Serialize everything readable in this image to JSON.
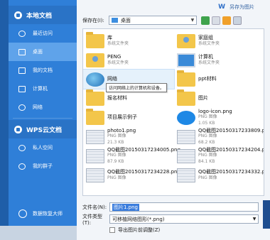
{
  "sidebar": {
    "local_header": "本地文档",
    "items": [
      {
        "label": "最近访问",
        "icon": "clock-icon",
        "active": false
      },
      {
        "label": "桌面",
        "icon": "desktop-icon",
        "active": true
      },
      {
        "label": "我的文档",
        "icon": "folder-icon",
        "active": false
      },
      {
        "label": "计算机",
        "icon": "computer-icon",
        "active": false
      },
      {
        "label": "网络",
        "icon": "network-icon",
        "active": false
      }
    ],
    "cloud_header": "WPS云文档",
    "cloud_items": [
      {
        "label": "私人空间",
        "icon": "person-icon"
      },
      {
        "label": "我的群子",
        "icon": "group-icon"
      }
    ],
    "bottom": "数据恢复大师"
  },
  "topbar": {
    "save_as_image": "另存为图片"
  },
  "savein": {
    "label": "保存在(I):",
    "value": "桌面"
  },
  "files": [
    {
      "name": "库",
      "type": "系统文件夹",
      "icon": "library-icon"
    },
    {
      "name": "家庭组",
      "type": "系统文件夹",
      "icon": "homegroup-icon"
    },
    {
      "name": "PENG",
      "type": "系统文件夹",
      "icon": "user-folder-icon"
    },
    {
      "name": "计算机",
      "type": "系统文件夹",
      "icon": "computer-icon"
    },
    {
      "name": "网络",
      "type": "",
      "icon": "network-icon",
      "tooltip": "访问网络上的计算机和设备。"
    },
    {
      "name": "ppt材料",
      "type": "",
      "icon": "folder-icon"
    },
    {
      "name": "报名材料",
      "type": "",
      "icon": "folder-icon"
    },
    {
      "name": "图片",
      "type": "",
      "icon": "folder-icon"
    },
    {
      "name": "项目展示例子",
      "type": "",
      "icon": "folder-icon"
    },
    {
      "name": "logo-icon.png",
      "type": "PNG 图像",
      "size": "1.05 KB",
      "icon": "cloud-image-icon"
    },
    {
      "name": "photo1.png",
      "type": "PNG 图像",
      "size": "21.3 KB",
      "icon": "image-icon"
    },
    {
      "name": "QQ截图20150317233809.png",
      "type": "PNG 图像",
      "size": "68.2 KB",
      "icon": "image-icon"
    },
    {
      "name": "QQ截图20150317234005.png",
      "type": "PNG 图像",
      "size": "87.9 KB",
      "icon": "image-icon"
    },
    {
      "name": "QQ截图20150317234204.png",
      "type": "PNG 图像",
      "size": "84.1 KB",
      "icon": "image-icon"
    },
    {
      "name": "QQ截图20150317234228.png",
      "type": "PNG 图像",
      "size": "",
      "icon": "image-icon"
    },
    {
      "name": "QQ截图20150317234332.png",
      "type": "PNG 图像",
      "size": "",
      "icon": "image-icon"
    }
  ],
  "filename": {
    "label": "文件名(N):",
    "value": "图片1.png"
  },
  "filetype": {
    "label": "文件类型(T):",
    "value": "可移植网络图形(*.png)"
  },
  "export_checkbox": "导出图片前调整(Z)"
}
